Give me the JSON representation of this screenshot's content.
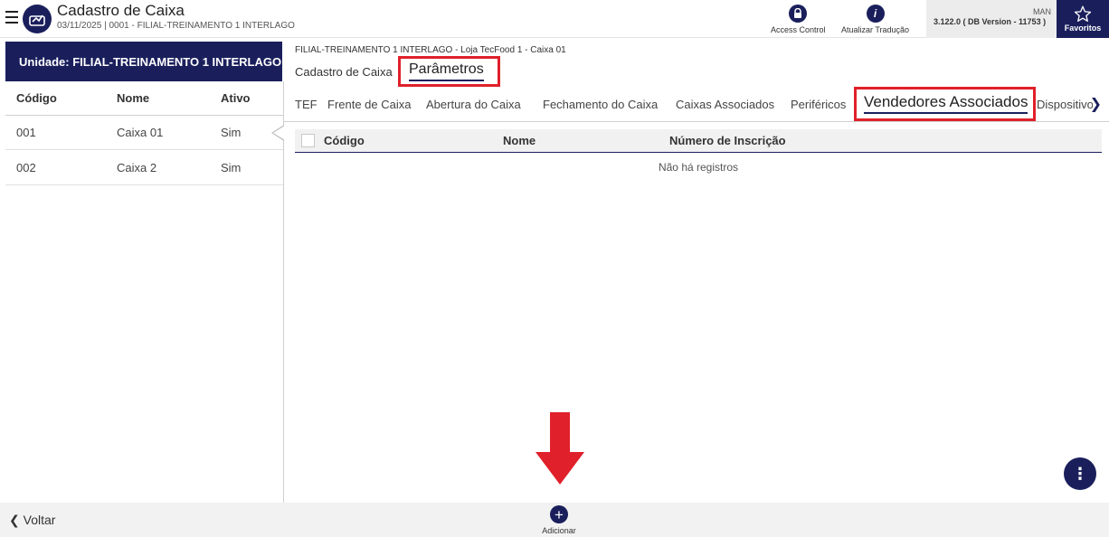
{
  "header": {
    "title": "Cadastro de Caixa",
    "subtitle": "03/11/2025 | 0001 - FILIAL-TREINAMENTO 1 INTERLAGO",
    "access_control_label": "Access Control",
    "atualizar_label": "Atualizar Tradução",
    "man_label": "MAN",
    "version_text": "3.122.0 ( DB Version - 11753 )",
    "favoritos_label": "Favoritos"
  },
  "left": {
    "unit_label": "Unidade: FILIAL-TREINAMENTO 1 INTERLAGO",
    "columns": [
      "Código",
      "Nome",
      "Ativo"
    ],
    "rows": [
      {
        "codigo": "001",
        "nome": "Caixa 01",
        "ativo": "Sim"
      },
      {
        "codigo": "002",
        "nome": "Caixa 2",
        "ativo": "Sim"
      }
    ]
  },
  "main": {
    "breadcrumb": "FILIAL-TREINAMENTO 1 INTERLAGO - Loja TecFood 1 - Caixa 01",
    "tabs": [
      "Cadastro de Caixa",
      "Parâmetros"
    ],
    "subtabs": [
      "TEF",
      "Frente de Caixa",
      "Abertura do Caixa",
      "Fechamento do Caixa",
      "Caixas Associados",
      "Periféricos",
      "Vendedores Associados",
      "Dispositivos"
    ],
    "grid_columns": [
      "Código",
      "Nome",
      "Número de Inscrição"
    ],
    "empty_message": "Não há registros"
  },
  "footer": {
    "back_label": "Voltar",
    "add_label": "Adicionar"
  },
  "icons": {
    "menu": "hamburger-icon",
    "app": "cash-register-icon",
    "access": "lock-icon",
    "info": "info-icon",
    "favorite": "star-icon",
    "more": "more-vertical-icon",
    "add": "plus-icon",
    "back": "chevron-left-icon",
    "next": "chevron-right-icon"
  },
  "colors": {
    "primary": "#1a1f5c",
    "highlight": "#e0202a"
  }
}
